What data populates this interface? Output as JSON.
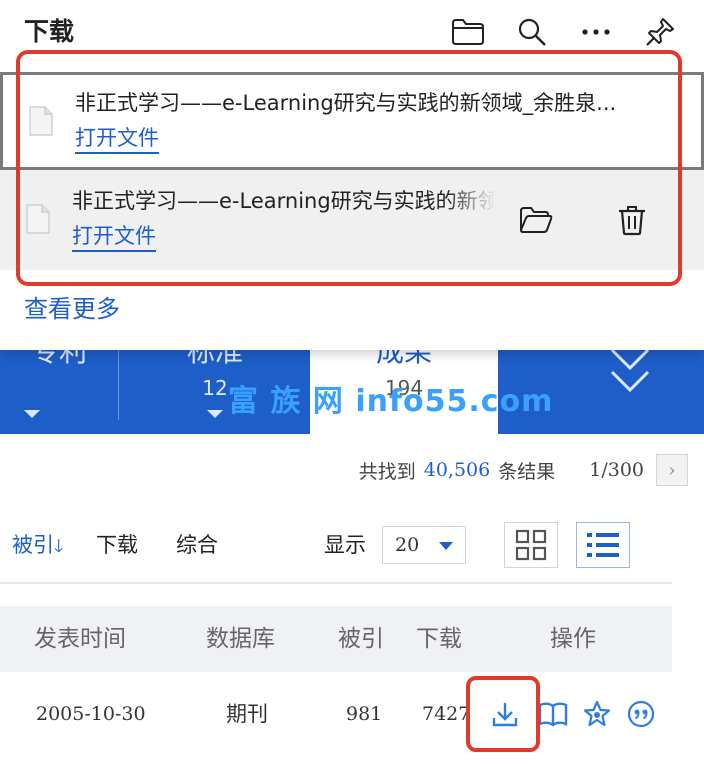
{
  "background": {
    "tabs": [
      {
        "title": "专利",
        "count": ""
      },
      {
        "title": "标准",
        "count": "12"
      },
      {
        "title": "成果",
        "count": "194"
      }
    ],
    "watermark": "富 族 网 info55.com",
    "results": {
      "prefix": "共找到",
      "count": "40,506",
      "suffix": "条结果",
      "page_indicator": "1/300",
      "next_glyph": "›"
    },
    "sort": {
      "cited": "被引",
      "cited_arrow": "🡓",
      "download": "下载",
      "overall": "综合",
      "display_label": "显示",
      "page_size": "20"
    },
    "table": {
      "headers": [
        "发表时间",
        "数据库",
        "被引",
        "下载",
        "操作"
      ],
      "row": {
        "date": "2005-10-30",
        "database": "期刊",
        "cited": "981",
        "downloads": "7427"
      }
    }
  },
  "popup": {
    "title": "下载",
    "items": [
      {
        "name": "非正式学习——e-Learning研究与实践的新领域_余胜泉...",
        "action": "打开文件"
      },
      {
        "name": "非正式学习——e-Learning研究与实践的新领域_余胜泉",
        "action": "打开文件"
      }
    ],
    "see_more": "查看更多"
  },
  "colors": {
    "brand_blue": "#1e5ec8",
    "highlight_red": "#e13a2a",
    "watermark_blue": "#3aa0ff"
  },
  "icons": {
    "header": [
      "folder-icon",
      "search-icon",
      "more-icon",
      "pin-icon"
    ],
    "item_actions": [
      "folder-open-icon",
      "trash-icon"
    ],
    "row_ops": [
      "download-icon",
      "read-icon",
      "favorite-icon",
      "cite-icon"
    ]
  }
}
